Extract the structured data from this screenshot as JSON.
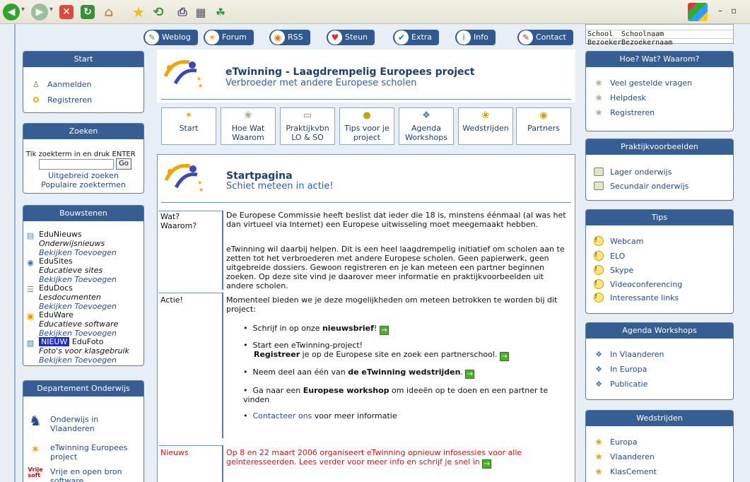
{
  "browser": {
    "back_icon": "back-icon",
    "forward_icon": "forward-icon",
    "stop_icon": "stop-icon",
    "refresh_icon": "refresh-icon",
    "home_icon": "home-icon",
    "favorites_icon": "favorites-icon",
    "history_icon": "history-icon",
    "print_icon": "print-icon",
    "minimize": "–",
    "restore": "ð"
  },
  "visitor": {
    "row1_label": "School",
    "row1_value": "Schoolnaam",
    "row2_label": "Bezoeker",
    "row2_value": "Bezoekernaam"
  },
  "topnav": [
    "Weblog",
    "Forum",
    "RSS",
    "Steun",
    "Extra",
    "Info",
    "Contact"
  ],
  "left": {
    "start": {
      "title": "Start",
      "items": [
        "Aanmelden",
        "Registreren"
      ]
    },
    "search": {
      "title": "Zoeken",
      "hint": "Tik zoekterm in en druk ENTER",
      "go": "Go",
      "links": [
        "Uitgebreid zoeken",
        "Populaire zoektermen"
      ]
    },
    "blocks": {
      "title": "Bouwstenen",
      "items": [
        {
          "name": "EduNieuws",
          "sub": "Onderwijsnieuws",
          "actions": "Bekijken  Toevoegen"
        },
        {
          "name": "EduSites",
          "sub": "Educatieve sites",
          "actions": "Bekijken  Toevoegen"
        },
        {
          "name": "EduDocs",
          "sub": "Lesdocumenten",
          "actions": "Bekijken  Toevoegen"
        },
        {
          "name": "EduWare",
          "sub": "Educatieve software",
          "actions": "Bekijken  Toevoegen"
        },
        {
          "name": "EduFoto",
          "badge": "NIEUW",
          "sub": "Foto's voor klasgebruik",
          "actions": "Bekijken  Toevoegen"
        }
      ]
    },
    "dept": {
      "title": "Departement Onderwijs",
      "items": [
        "Onderwijs in Vlaanderen",
        "eTwinning Europees project",
        "Vrije en open bron software"
      ]
    }
  },
  "header": {
    "title": "eTwinning - Laagdrempelig Europees project",
    "subtitle": "Verbroeder met andere Europese scholen"
  },
  "tabs": [
    {
      "l1": "Start",
      "l2": ""
    },
    {
      "l1": "Hoe Wat",
      "l2": "Waarom"
    },
    {
      "l1": "Praktijkvbn",
      "l2": "LO & SO"
    },
    {
      "l1": "Tips voor je",
      "l2": "project"
    },
    {
      "l1": "Agenda",
      "l2": "Workshops"
    },
    {
      "l1": "Wedstrijden",
      "l2": ""
    },
    {
      "l1": "Partners",
      "l2": ""
    }
  ],
  "content": {
    "title": "Startpagina",
    "subtitle": "Schiet meteen in actie!",
    "wat_label_1": "Wat?",
    "wat_label_2": "Waarom?",
    "wat_p1": "De Europese Commissie heeft beslist dat ieder die 18 is, minstens éénmaal (al was het dan virtueel via Internet) een Europese uitwisseling moet meegemaakt hebben.",
    "wat_p2": "eTwinning wil daarbij helpen. Dit is een heel laagdrempelig initiatief om scholen aan te zetten tot het verbroederen met andere Europese scholen. Geen papierwerk, geen uitgebreide dossiers. Gewoon registreren en je kan meteen een partner beginnen zoeken. Op deze site vind je daarover meer informatie en praktijkvoorbeelden uit andere scholen.",
    "actie_label": "Actie!",
    "actie_intro": "Momenteel bieden we je deze mogelijkheden om meteen betrokken te worden bij dit project:",
    "b1_pre": "Schrijf in op onze ",
    "b1_bold": "nieuwsbrief",
    "b1_post": "!",
    "b2_line1": "Start een eTwinning-project!",
    "b2_bold": "Registreer",
    "b2_post": " je op de Europese site en zoek een partnerschool.",
    "b3_pre": "Neem deel aan één van ",
    "b3_bold": "de eTwinning wedstrijden",
    "b3_post": ".",
    "b4_pre": "Ga naar een ",
    "b4_bold": "Europese workshop",
    "b4_post": " om ideeën op te doen en een partner te vinden",
    "b5_link": "Contacteer ons",
    "b5_post": " voor meer informatie",
    "news_label": "Nieuws",
    "news_text": "Op 8 en 22 maart 2006 organiseert eTwinning opnieuw infosessies voor alle geïnteresseerden. Lees verder voor meer info en schrijf je snel in"
  },
  "right": {
    "hoe": {
      "title": "Hoe? Wat? Waarom?",
      "items": [
        "Veel gestelde vragen",
        "Helpdesk",
        "Registreren"
      ]
    },
    "prak": {
      "title": "Praktijkvoorbeelden",
      "items": [
        "Lager onderwijs",
        "Secundair onderwijs"
      ]
    },
    "tips": {
      "title": "Tips",
      "items": [
        "Webcam",
        "ELO",
        "Skype",
        "Videoconferencing",
        "Interessante links"
      ]
    },
    "agenda": {
      "title": "Agenda Workshops",
      "items": [
        "In Vlaanderen",
        "In Europa",
        "Publicatie"
      ]
    },
    "wed": {
      "title": "Wedstrijden",
      "items": [
        "Europa",
        "Vlaanderen",
        "KlasCement"
      ]
    }
  }
}
